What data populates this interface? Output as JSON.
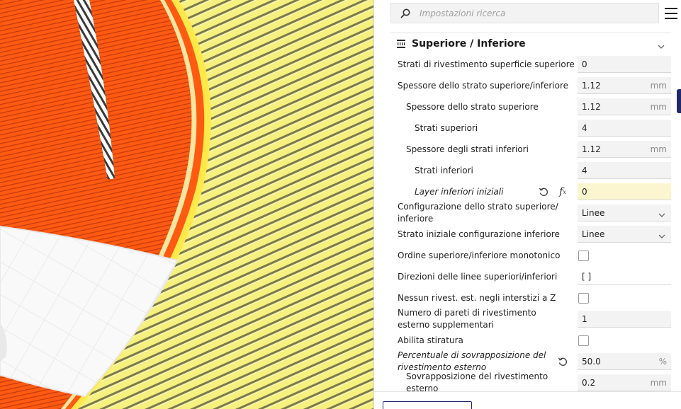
{
  "search": {
    "placeholder": "Impostazioni ricerca",
    "icon": "search-icon"
  },
  "menu": {
    "icon": "hamburger-icon"
  },
  "section": {
    "title": "Superiore / Inferiore",
    "icon": "top-bottom-layers-icon",
    "chevron": "chevron-down-icon"
  },
  "settings": [
    {
      "label": "Strati di rivestimento superficie superiore",
      "value": "0"
    },
    {
      "label": "Spessore dello strato superiore/inferiore",
      "value": "1.12",
      "unit": "mm"
    },
    {
      "label": "Spessore dello strato superiore",
      "value": "1.12",
      "unit": "mm"
    },
    {
      "label": "Strati superiori",
      "value": "4"
    },
    {
      "label": "Spessore degli strati inferiori",
      "value": "1.12",
      "unit": "mm"
    },
    {
      "label": "Strati inferiori",
      "value": "4"
    },
    {
      "label": "Layer inferiori iniziali",
      "value": "0"
    },
    {
      "label": "Configurazione dello strato superiore/ inferiore",
      "value": "Linee"
    },
    {
      "label": "Strato iniziale configurazione inferiore",
      "value": "Linee"
    },
    {
      "label": "Ordine superiore/inferiore monotonico"
    },
    {
      "label": "Direzioni delle linee superiori/inferiori",
      "value": "[ ]"
    },
    {
      "label": "Nessun rivest. est. negli interstizi a Z"
    },
    {
      "label": "Numero di pareti di rivestimento esterno supplementari",
      "value": "1"
    },
    {
      "label": "Abilita stiratura"
    },
    {
      "label": "Percentuale di sovrapposizione del rivestimento esterno",
      "value": "50.0",
      "unit": "%"
    },
    {
      "label": "Sovrapposizione del rivestimento esterno",
      "value": "0.2",
      "unit": "mm"
    }
  ],
  "colors": {
    "accent": "#1e2a6e",
    "print_orange": "#ff5a0f",
    "print_yellow": "#f5ef7c",
    "highlight_field": "#fbf6cf"
  }
}
